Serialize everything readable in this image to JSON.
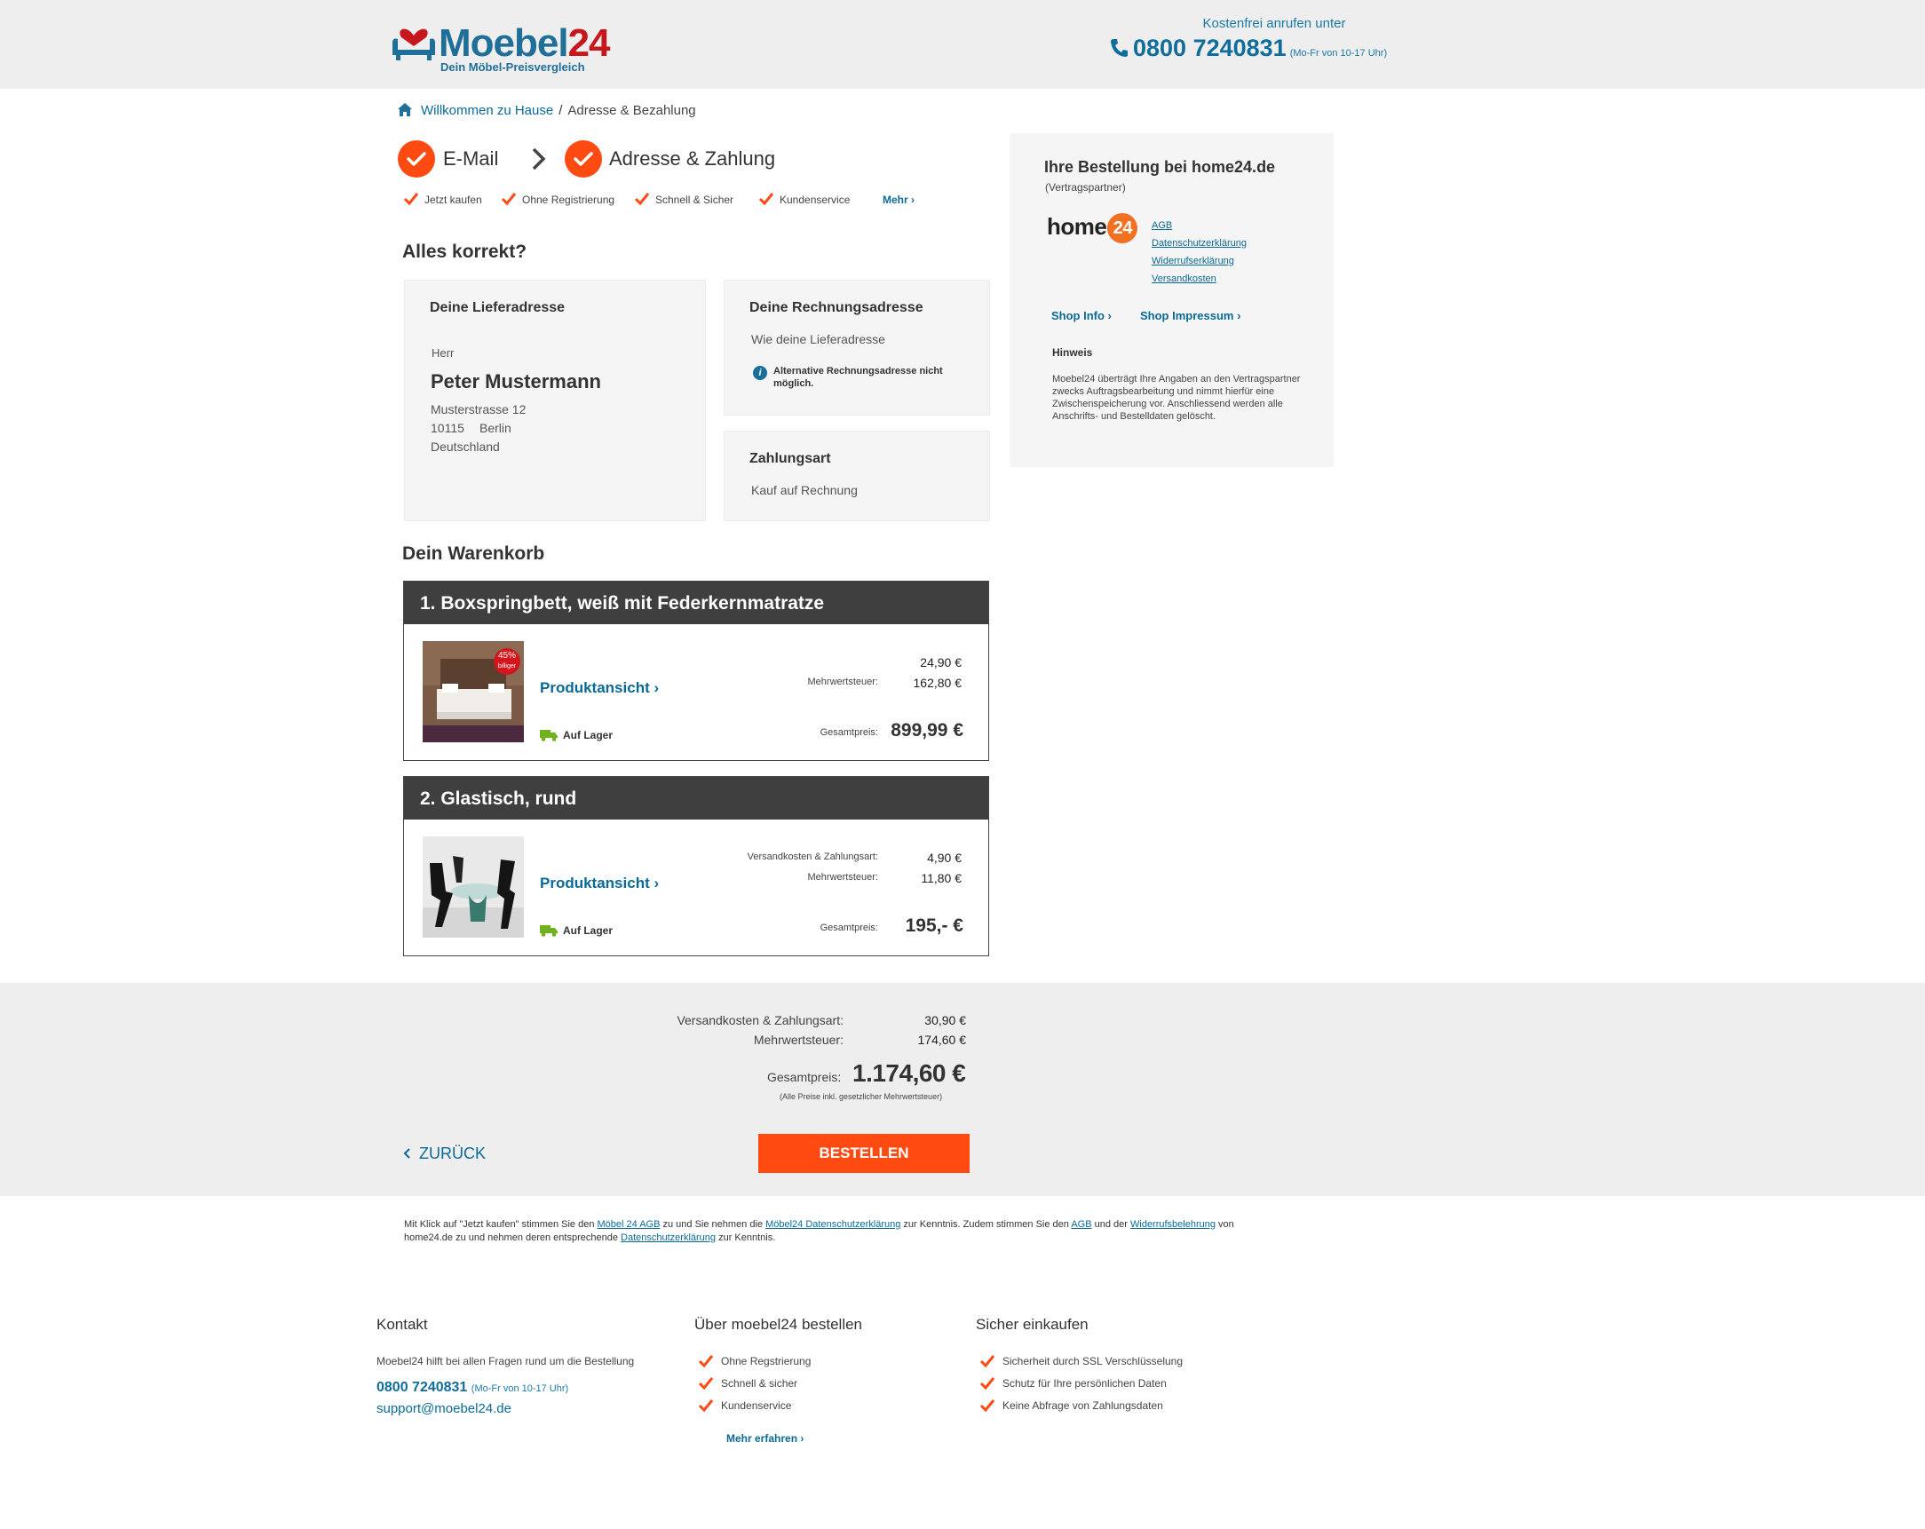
{
  "header": {
    "brand_main": "Moebel",
    "brand_num": "24",
    "tagline": "Dein Möbel-Preisvergleich",
    "hotline_label": "Kostenfrei anrufen unter",
    "phone": "0800 7240831",
    "hours": "(Mo-Fr von 10-17 Uhr)"
  },
  "breadcrumb": {
    "home": "Willkommen zu Hause",
    "separator": "/",
    "current": "Adresse & Bezahlung"
  },
  "steps": [
    {
      "label": "E-Mail"
    },
    {
      "label": "Adresse & Zahlung"
    }
  ],
  "usps": [
    "Jetzt kaufen",
    "Ohne Registrierung",
    "Schnell & Sicher",
    "Kundenservice"
  ],
  "usps_more": "Mehr",
  "review": {
    "title": "Alles korrekt?",
    "delivery": {
      "heading": "Deine Lieferadresse",
      "salutation": "Herr",
      "name": "Peter Mustermann",
      "street": "Musterstrasse 12",
      "zip": "10115",
      "city": "Berlin",
      "country": "Deutschland"
    },
    "billing": {
      "heading": "Deine Rechnungsadresse",
      "text": "Wie deine Lieferadresse",
      "note": "Alternative Rechnungsadresse nicht möglich."
    },
    "payment": {
      "heading": "Zahlungsart",
      "method": "Kauf auf Rechnung"
    }
  },
  "cart": {
    "title": "Dein Warenkorb",
    "items": [
      {
        "title": "1.  Boxspringbett, weiß mit Federkernmatratze",
        "badge_pct": "45%",
        "badge_text": "billiger",
        "link": "Produktansicht",
        "stock": "Auf Lager",
        "first_value": "24,90 €",
        "vat_label": "Mehrwertsteuer:",
        "vat_value": "162,80 €",
        "total_label": "Gesamtpreis:",
        "total": "899,99 €"
      },
      {
        "title": "2.  Glastisch, rund",
        "link": "Produktansicht",
        "stock": "Auf Lager",
        "shipping_label": "Versandkosten & Zahlungsart:",
        "shipping_value": "4,90 €",
        "vat_label": "Mehrwertsteuer:",
        "vat_value": "11,80 €",
        "total_label": "Gesamtpreis:",
        "total": "195,- €"
      }
    ]
  },
  "summary": {
    "shipping_label": "Versandkosten & Zahlungsart:",
    "shipping_value": "30,90 €",
    "vat_label": "Mehrwertsteuer:",
    "vat_value": "174,60 €",
    "total_label": "Gesamtpreis:",
    "total": "1.174,60 €",
    "fine": "(Alle Preise inkl. gesetzlicher Mehrwertsteuer)",
    "back": "ZURÜCK",
    "order": "BESTELLEN"
  },
  "side": {
    "title": "Ihre Bestellung bei home24.de",
    "subtitle": "(Vertragspartner)",
    "partner_text": "home",
    "partner_num": "24",
    "links": [
      "AGB",
      "Datenschutzerklärung",
      "Widerrufserklärung",
      "Versandkosten"
    ],
    "shop_info": "Shop Info",
    "shop_impressum": "Shop Impressum",
    "hint_title": "Hinweis",
    "hint_text": "Moebel24 überträgt Ihre Angaben an den Vertragspartner zwecks Auftragsbearbeitung und nimmt hierfür eine Zwischenspeicherung vor. Anschliessend werden alle Anschrifts- und Bestelldaten gelöscht."
  },
  "legal": {
    "t1": "Mit Klick auf \"Jetzt kaufen\" stimmen Sie den ",
    "l1": "Möbel 24 AGB",
    "t2": " zu und Sie nehmen die ",
    "l2": "Möbel24 Datenschutzerklärung",
    "t3": " zur Kenntnis. Zudem stimmen Sie den ",
    "l3": "AGB",
    "t4": " und der ",
    "l4": "Widerrufsbelehrung",
    "t5": " von home24.de zu und nehmen deren entsprechende ",
    "l5": "Datenschutzerklärung",
    "t6": " zur Kenntnis."
  },
  "footer": {
    "contact_title": "Kontakt",
    "contact_text": "Moebel24 hilft bei allen Fragen rund um die Bestellung",
    "phone": "0800 7240831",
    "hours": "(Mo-Fr von 10-17 Uhr)",
    "email": "support@moebel24.de",
    "order_title": "Über moebel24 bestellen",
    "order_items": [
      "Ohne Regstrierung",
      "Schnell & sicher",
      "Kundenservice"
    ],
    "order_more": "Mehr erfahren",
    "secure_title": "Sicher einkaufen",
    "secure_items": [
      "Sicherheit durch SSL Verschlüsselung",
      "Schutz für Ihre persönlichen Daten",
      "Keine Abfrage von Zahlungsdaten"
    ]
  }
}
